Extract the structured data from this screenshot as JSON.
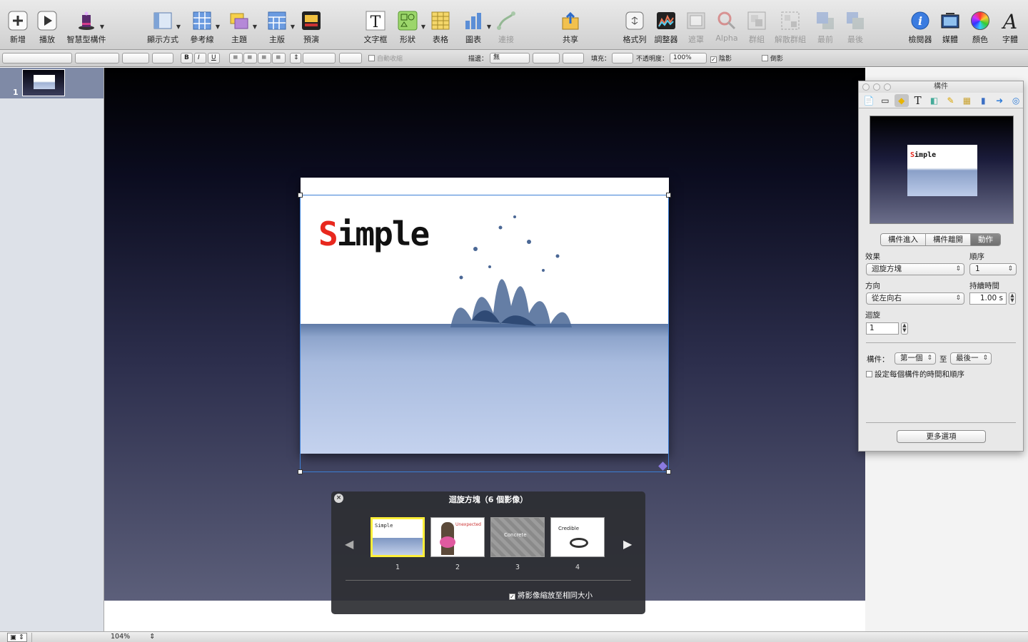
{
  "toolbar": {
    "new": "新增",
    "play": "播放",
    "smart_builds": "智慧型構件",
    "view": "顯示方式",
    "guides": "參考線",
    "themes": "主題",
    "masters": "主版",
    "preview": "預演",
    "text_box": "文字框",
    "shapes": "形狀",
    "table": "表格",
    "chart": "圖表",
    "connection": "連接",
    "share": "共享",
    "format_bar": "格式列",
    "adjust": "調整器",
    "mask": "遮罩",
    "alpha": "Alpha",
    "group": "群組",
    "ungroup": "解散群組",
    "front": "最前",
    "back": "最後",
    "inspector": "檢閱器",
    "media": "媒體",
    "colors": "顏色",
    "fonts": "字體"
  },
  "format_bar": {
    "bold": "B",
    "italic": "I",
    "underline": "U",
    "autoshrink": "自動收縮",
    "stroke_label": "描邊：",
    "stroke_value": "無",
    "fill_label": "填充：",
    "opacity_label": "不透明度：",
    "opacity_value": "100%",
    "shadow": "陰影",
    "reflection": "倒影",
    "shadow_checked": "✓"
  },
  "navigator": {
    "slide_number": "1"
  },
  "slide": {
    "title_s": "S",
    "title_rest": "imple"
  },
  "inspector": {
    "window_title": "構件",
    "tabs": [
      "構件進入",
      "構件離開",
      "動作"
    ],
    "effect_label": "效果",
    "effect_value": "迴旋方塊",
    "order_label": "順序",
    "order_value": "1",
    "direction_label": "方向",
    "direction_value": "從左向右",
    "duration_label": "持續時間",
    "duration_value": "1.00 s",
    "spin_label": "迴旋",
    "spin_value": "1",
    "builds_label": "構件：",
    "builds_from": "第一個",
    "builds_to_label": "至",
    "builds_to": "最後一",
    "per_item_label": "設定每個構件的時間和順序",
    "more_options": "更多選項"
  },
  "hud": {
    "title": "迴旋方塊（6 個影像）",
    "thumbs": [
      {
        "num": "1",
        "caption": "Simple"
      },
      {
        "num": "2",
        "caption": "Unexpected"
      },
      {
        "num": "3",
        "caption": "Concrete"
      },
      {
        "num": "4",
        "caption": "Credible"
      }
    ],
    "scale_label": "將影像縮放至相同大小",
    "scale_checked": "✓"
  },
  "statusbar": {
    "zoom": "104%"
  }
}
